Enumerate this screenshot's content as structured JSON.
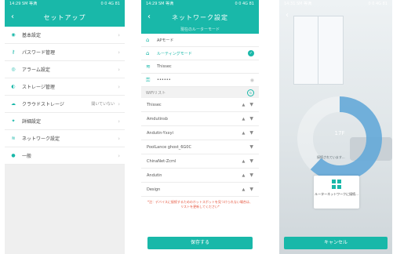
{
  "screen1": {
    "status_time": "14:29 SM 等满",
    "status_right": "0 0 4G 81",
    "back_icon": "chevron-left-icon",
    "title": "セットアップ",
    "items": [
      {
        "icon": "basic-settings-icon",
        "label": "基本設定",
        "value": ""
      },
      {
        "icon": "password-icon",
        "label": "パスワード管理",
        "value": ""
      },
      {
        "icon": "alarm-icon",
        "label": "アラーム設定",
        "value": ""
      },
      {
        "icon": "storage-icon",
        "label": "ストレージ管理",
        "value": ""
      },
      {
        "icon": "cloud-icon",
        "label": "クラウドストレージ",
        "value": "開いていない"
      },
      {
        "icon": "advanced-icon",
        "label": "詳細設定",
        "value": ""
      },
      {
        "icon": "wifi-icon",
        "label": "ネットワーク設定",
        "value": ""
      },
      {
        "icon": "general-icon",
        "label": "一般",
        "value": ""
      }
    ]
  },
  "screen2": {
    "status_time": "14:29 SM 等满",
    "status_right": "0 0 4G 81",
    "title": "ネットワーク設定",
    "subtitle": "現在のルーターモード",
    "ap_mode_label": "APモード",
    "routing_mode_label": "ルーティングモード",
    "current_ssid": "Thissec",
    "password_placeholder": "••••••",
    "wifi_list_label": "WiFiリスト",
    "networks": [
      {
        "name": "Thissec",
        "locked": true
      },
      {
        "name": "Amdutinsb",
        "locked": true
      },
      {
        "name": "Andutin-Yxxyi",
        "locked": true
      },
      {
        "name": "PoolLance ghost_6G0C",
        "locked": false
      },
      {
        "name": "ChinaNet-Zcml",
        "locked": true
      },
      {
        "name": "Andutin",
        "locked": true
      },
      {
        "name": "Design",
        "locked": true
      }
    ],
    "warning": "*注：デバイスに接続するためのホットスポットを見つけられない場合は、リストを更新してください*",
    "save_button": "保存する"
  },
  "screen3": {
    "status_time": "14:31 SM 等满",
    "status_right": "0 0 4G 81",
    "progress_text": "17F",
    "progress_fraction": 0.62,
    "hint": "接続されています...",
    "connect_text": "ルーターネットワークに接続...",
    "cancel_button": "キャンセル"
  },
  "colors": {
    "accent": "#19b8a9",
    "warning": "#e5533b"
  }
}
